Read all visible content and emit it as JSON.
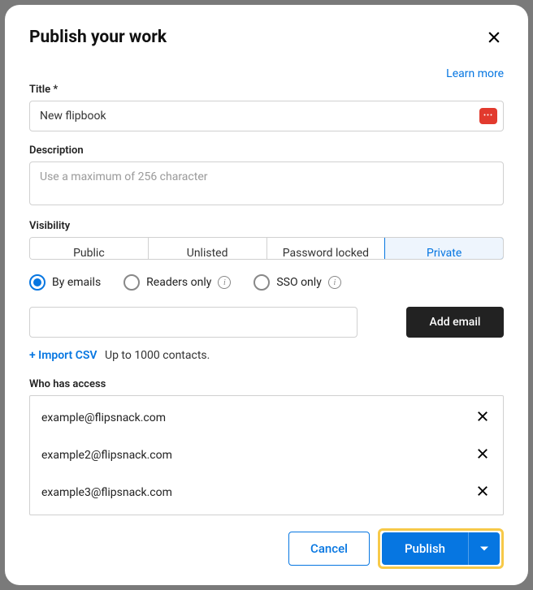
{
  "header": {
    "title": "Publish your work",
    "learn_more": "Learn more"
  },
  "title_field": {
    "label": "Title *",
    "value": "New flipbook"
  },
  "description_field": {
    "label": "Description",
    "placeholder": "Use a maximum of 256 character"
  },
  "visibility": {
    "label": "Visibility",
    "tabs": {
      "public": "Public",
      "unlisted": "Unlisted",
      "password": "Password locked",
      "private": "Private"
    }
  },
  "private_mode": {
    "by_emails": "By emails",
    "readers_only": "Readers only",
    "sso_only": "SSO only"
  },
  "add_email": {
    "button": "Add email"
  },
  "import": {
    "link": "+ Import CSV",
    "note": "Up to 1000 contacts."
  },
  "access": {
    "label": "Who has access",
    "list": [
      "example@flipsnack.com",
      "example2@flipsnack.com",
      "example3@flipsnack.com"
    ]
  },
  "footer": {
    "cancel": "Cancel",
    "publish": "Publish"
  }
}
